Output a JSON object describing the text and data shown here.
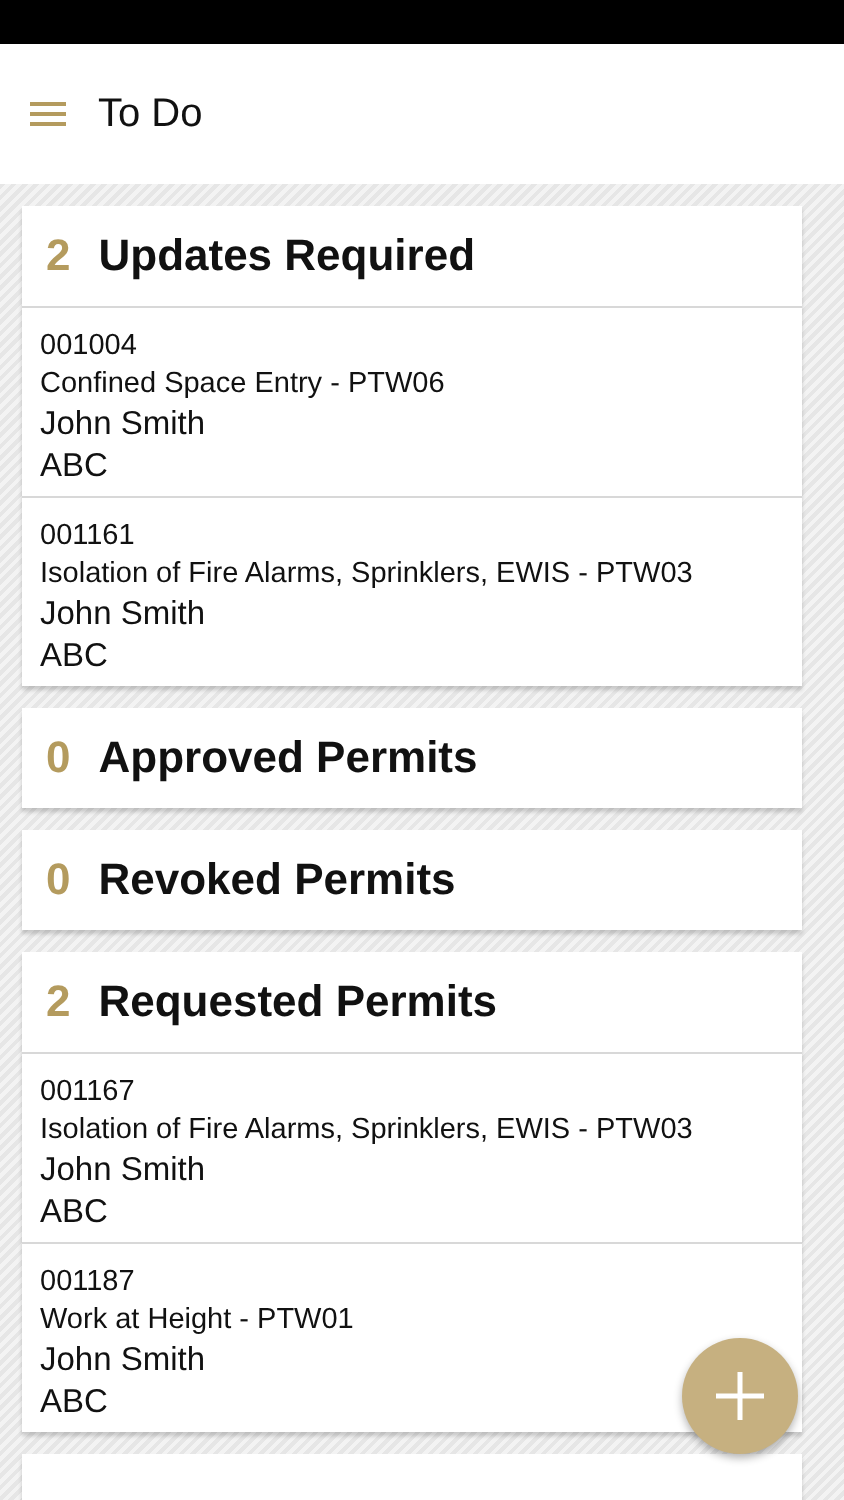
{
  "header": {
    "title": "To Do"
  },
  "sections": [
    {
      "count": "2",
      "title": "Updates Required",
      "items": [
        {
          "number": "001004",
          "permit": "Confined Space Entry - PTW06",
          "person": "John Smith",
          "company": "ABC"
        },
        {
          "number": "001161",
          "permit": "Isolation of Fire Alarms, Sprinklers, EWIS - PTW03",
          "person": "John Smith",
          "company": "ABC"
        }
      ]
    },
    {
      "count": "0",
      "title": "Approved Permits"
    },
    {
      "count": "0",
      "title": "Revoked Permits"
    },
    {
      "count": "2",
      "title": "Requested Permits",
      "items": [
        {
          "number": "001167",
          "permit": "Isolation of Fire Alarms, Sprinklers, EWIS - PTW03",
          "person": "John Smith",
          "company": "ABC"
        },
        {
          "number": "001187",
          "permit": "Work at Height - PTW01",
          "person": "John Smith",
          "company": "ABC"
        }
      ]
    }
  ]
}
